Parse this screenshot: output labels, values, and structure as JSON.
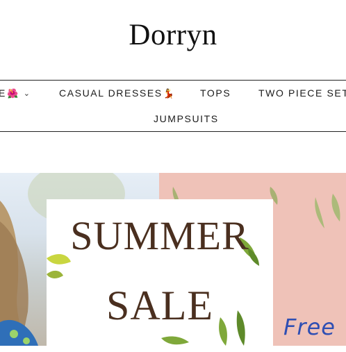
{
  "header": {
    "logo": "Dorryn"
  },
  "nav": {
    "row1": [
      {
        "label": "E",
        "emoji": "🌺",
        "has_dropdown": true
      },
      {
        "label": "CASUAL DRESSES",
        "emoji": "💃"
      },
      {
        "label": "TOPS"
      },
      {
        "label": "TWO PIECE SET"
      }
    ],
    "row2": [
      {
        "label": "JUMPSUITS"
      }
    ]
  },
  "hero": {
    "line1": "SUMMER",
    "line2": "SALE",
    "free_text": "Free",
    "colors": {
      "pink": "#efc2b8",
      "brown": "#4a2f1f",
      "blue": "#2f4fb3",
      "leaf": "#7fa83a"
    }
  }
}
